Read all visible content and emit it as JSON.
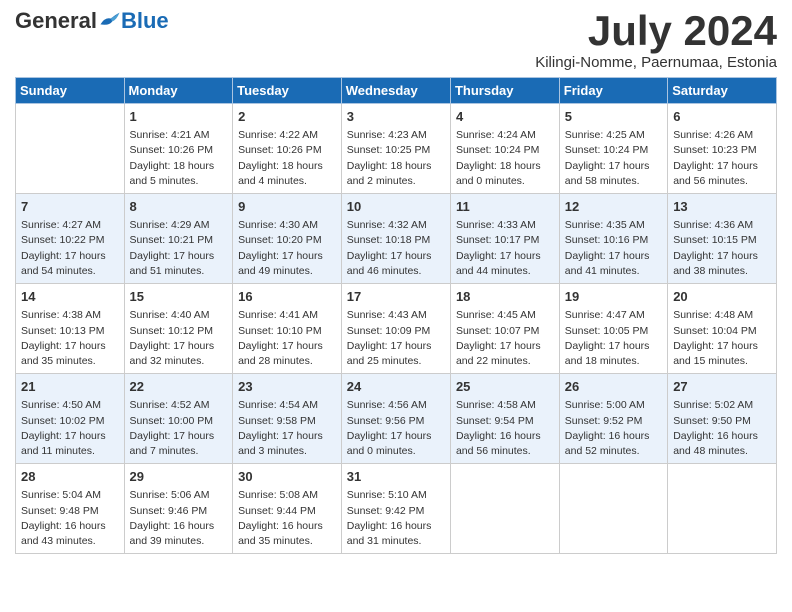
{
  "logo": {
    "general": "General",
    "blue": "Blue"
  },
  "header": {
    "month": "July 2024",
    "location": "Kilingi-Nomme, Paernumaa, Estonia"
  },
  "weekdays": [
    "Sunday",
    "Monday",
    "Tuesday",
    "Wednesday",
    "Thursday",
    "Friday",
    "Saturday"
  ],
  "weeks": [
    [
      {
        "day": "",
        "info": ""
      },
      {
        "day": "1",
        "info": "Sunrise: 4:21 AM\nSunset: 10:26 PM\nDaylight: 18 hours\nand 5 minutes."
      },
      {
        "day": "2",
        "info": "Sunrise: 4:22 AM\nSunset: 10:26 PM\nDaylight: 18 hours\nand 4 minutes."
      },
      {
        "day": "3",
        "info": "Sunrise: 4:23 AM\nSunset: 10:25 PM\nDaylight: 18 hours\nand 2 minutes."
      },
      {
        "day": "4",
        "info": "Sunrise: 4:24 AM\nSunset: 10:24 PM\nDaylight: 18 hours\nand 0 minutes."
      },
      {
        "day": "5",
        "info": "Sunrise: 4:25 AM\nSunset: 10:24 PM\nDaylight: 17 hours\nand 58 minutes."
      },
      {
        "day": "6",
        "info": "Sunrise: 4:26 AM\nSunset: 10:23 PM\nDaylight: 17 hours\nand 56 minutes."
      }
    ],
    [
      {
        "day": "7",
        "info": "Sunrise: 4:27 AM\nSunset: 10:22 PM\nDaylight: 17 hours\nand 54 minutes."
      },
      {
        "day": "8",
        "info": "Sunrise: 4:29 AM\nSunset: 10:21 PM\nDaylight: 17 hours\nand 51 minutes."
      },
      {
        "day": "9",
        "info": "Sunrise: 4:30 AM\nSunset: 10:20 PM\nDaylight: 17 hours\nand 49 minutes."
      },
      {
        "day": "10",
        "info": "Sunrise: 4:32 AM\nSunset: 10:18 PM\nDaylight: 17 hours\nand 46 minutes."
      },
      {
        "day": "11",
        "info": "Sunrise: 4:33 AM\nSunset: 10:17 PM\nDaylight: 17 hours\nand 44 minutes."
      },
      {
        "day": "12",
        "info": "Sunrise: 4:35 AM\nSunset: 10:16 PM\nDaylight: 17 hours\nand 41 minutes."
      },
      {
        "day": "13",
        "info": "Sunrise: 4:36 AM\nSunset: 10:15 PM\nDaylight: 17 hours\nand 38 minutes."
      }
    ],
    [
      {
        "day": "14",
        "info": "Sunrise: 4:38 AM\nSunset: 10:13 PM\nDaylight: 17 hours\nand 35 minutes."
      },
      {
        "day": "15",
        "info": "Sunrise: 4:40 AM\nSunset: 10:12 PM\nDaylight: 17 hours\nand 32 minutes."
      },
      {
        "day": "16",
        "info": "Sunrise: 4:41 AM\nSunset: 10:10 PM\nDaylight: 17 hours\nand 28 minutes."
      },
      {
        "day": "17",
        "info": "Sunrise: 4:43 AM\nSunset: 10:09 PM\nDaylight: 17 hours\nand 25 minutes."
      },
      {
        "day": "18",
        "info": "Sunrise: 4:45 AM\nSunset: 10:07 PM\nDaylight: 17 hours\nand 22 minutes."
      },
      {
        "day": "19",
        "info": "Sunrise: 4:47 AM\nSunset: 10:05 PM\nDaylight: 17 hours\nand 18 minutes."
      },
      {
        "day": "20",
        "info": "Sunrise: 4:48 AM\nSunset: 10:04 PM\nDaylight: 17 hours\nand 15 minutes."
      }
    ],
    [
      {
        "day": "21",
        "info": "Sunrise: 4:50 AM\nSunset: 10:02 PM\nDaylight: 17 hours\nand 11 minutes."
      },
      {
        "day": "22",
        "info": "Sunrise: 4:52 AM\nSunset: 10:00 PM\nDaylight: 17 hours\nand 7 minutes."
      },
      {
        "day": "23",
        "info": "Sunrise: 4:54 AM\nSunset: 9:58 PM\nDaylight: 17 hours\nand 3 minutes."
      },
      {
        "day": "24",
        "info": "Sunrise: 4:56 AM\nSunset: 9:56 PM\nDaylight: 17 hours\nand 0 minutes."
      },
      {
        "day": "25",
        "info": "Sunrise: 4:58 AM\nSunset: 9:54 PM\nDaylight: 16 hours\nand 56 minutes."
      },
      {
        "day": "26",
        "info": "Sunrise: 5:00 AM\nSunset: 9:52 PM\nDaylight: 16 hours\nand 52 minutes."
      },
      {
        "day": "27",
        "info": "Sunrise: 5:02 AM\nSunset: 9:50 PM\nDaylight: 16 hours\nand 48 minutes."
      }
    ],
    [
      {
        "day": "28",
        "info": "Sunrise: 5:04 AM\nSunset: 9:48 PM\nDaylight: 16 hours\nand 43 minutes."
      },
      {
        "day": "29",
        "info": "Sunrise: 5:06 AM\nSunset: 9:46 PM\nDaylight: 16 hours\nand 39 minutes."
      },
      {
        "day": "30",
        "info": "Sunrise: 5:08 AM\nSunset: 9:44 PM\nDaylight: 16 hours\nand 35 minutes."
      },
      {
        "day": "31",
        "info": "Sunrise: 5:10 AM\nSunset: 9:42 PM\nDaylight: 16 hours\nand 31 minutes."
      },
      {
        "day": "",
        "info": ""
      },
      {
        "day": "",
        "info": ""
      },
      {
        "day": "",
        "info": ""
      }
    ]
  ]
}
